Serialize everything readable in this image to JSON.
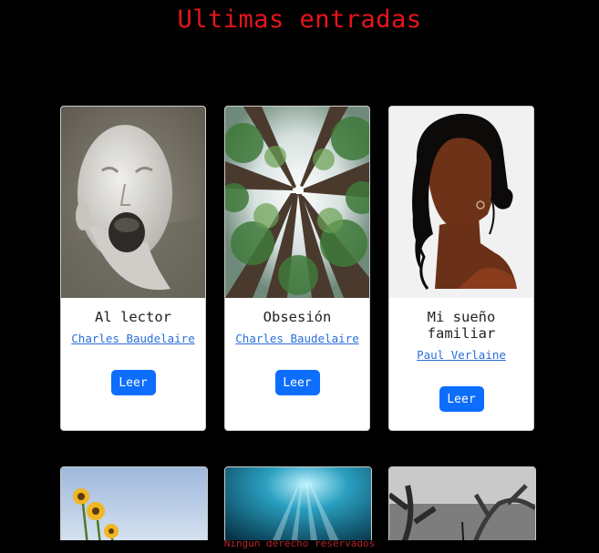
{
  "page": {
    "title": "Ultimas entradas"
  },
  "cards": [
    {
      "title": "Al lector",
      "author": "Charles Baudelaire",
      "button": "Leer",
      "image": "screaming-head-sculpture-image"
    },
    {
      "title": "Obsesión",
      "author": "Charles Baudelaire",
      "button": "Leer",
      "image": "forest-canopy-image"
    },
    {
      "title": "Mi sueño familiar",
      "author": "Paul Verlaine",
      "button": "Leer",
      "image": "woman-silhouette-illustration-image"
    }
  ],
  "second_row_images": [
    "sunflowers-image",
    "underwater-light-rays-image",
    "dark-tree-image"
  ],
  "footer": {
    "text": "Ningún derecho reservados"
  },
  "colors": {
    "background": "#000000",
    "title": "#e8141c",
    "button": "#0d6efd",
    "link": "#2a6fdb"
  }
}
